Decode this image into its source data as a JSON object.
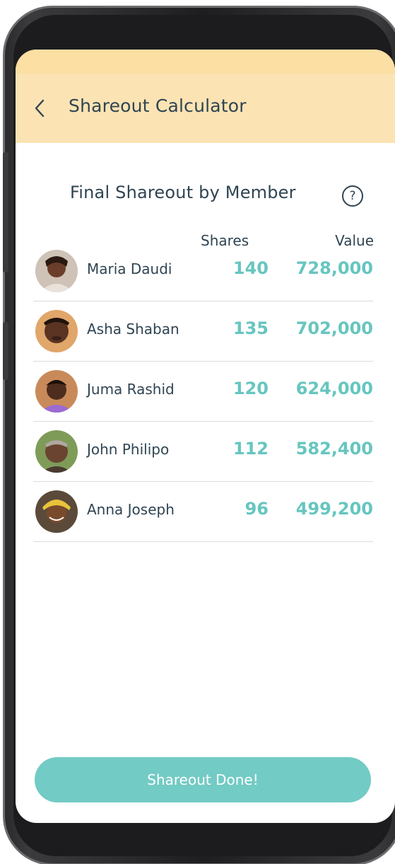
{
  "header": {
    "title": "Shareout Calculator",
    "back_icon": "chevron-left-icon"
  },
  "section": {
    "title": "Final Shareout by Member",
    "help_icon": "?"
  },
  "table": {
    "columns": [
      "Shares",
      "Value"
    ],
    "rows": [
      {
        "name": "Maria Daudi",
        "shares": "140",
        "value": "728,000",
        "avatar_color": "#7a4a34"
      },
      {
        "name": "Asha Shaban",
        "shares": "135",
        "value": "702,000",
        "avatar_color": "#6b3e2a"
      },
      {
        "name": "Juma Rashid",
        "shares": "120",
        "value": "624,000",
        "avatar_color": "#5a3526"
      },
      {
        "name": "John Philipo",
        "shares": "112",
        "value": "582,400",
        "avatar_color": "#6e4a36"
      },
      {
        "name": "Anna Joseph",
        "shares": "96",
        "value": "499,200",
        "avatar_color": "#8a5a2c"
      }
    ]
  },
  "footer": {
    "button_label": "Shareout Done!"
  },
  "colors": {
    "accent": "#66c6bf",
    "header_bg": "#fbe3b3",
    "text": "#2f4452",
    "button": "#72cbc4"
  }
}
